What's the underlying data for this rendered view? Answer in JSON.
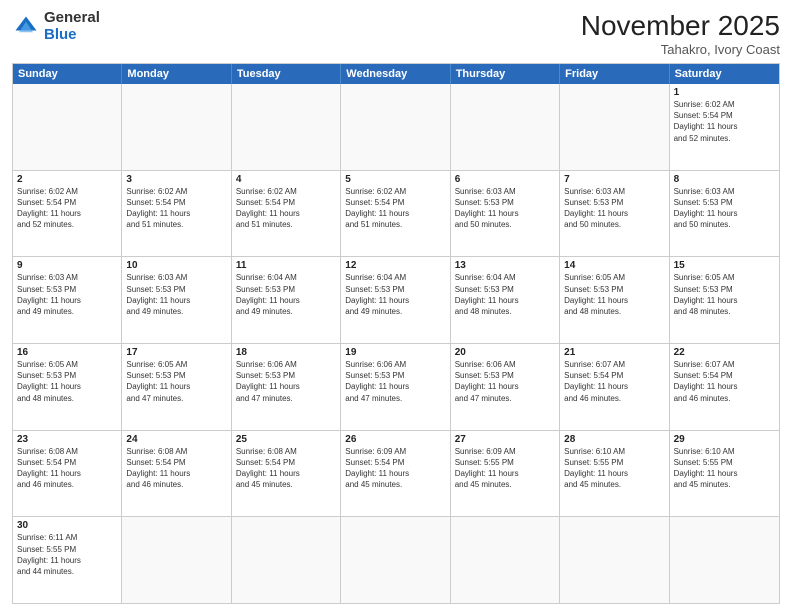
{
  "header": {
    "logo_general": "General",
    "logo_blue": "Blue",
    "month_title": "November 2025",
    "subtitle": "Tahakro, Ivory Coast"
  },
  "day_headers": [
    "Sunday",
    "Monday",
    "Tuesday",
    "Wednesday",
    "Thursday",
    "Friday",
    "Saturday"
  ],
  "weeks": [
    [
      {
        "num": "",
        "info": ""
      },
      {
        "num": "",
        "info": ""
      },
      {
        "num": "",
        "info": ""
      },
      {
        "num": "",
        "info": ""
      },
      {
        "num": "",
        "info": ""
      },
      {
        "num": "",
        "info": ""
      },
      {
        "num": "1",
        "info": "Sunrise: 6:02 AM\nSunset: 5:54 PM\nDaylight: 11 hours\nand 52 minutes."
      }
    ],
    [
      {
        "num": "2",
        "info": "Sunrise: 6:02 AM\nSunset: 5:54 PM\nDaylight: 11 hours\nand 52 minutes."
      },
      {
        "num": "3",
        "info": "Sunrise: 6:02 AM\nSunset: 5:54 PM\nDaylight: 11 hours\nand 51 minutes."
      },
      {
        "num": "4",
        "info": "Sunrise: 6:02 AM\nSunset: 5:54 PM\nDaylight: 11 hours\nand 51 minutes."
      },
      {
        "num": "5",
        "info": "Sunrise: 6:02 AM\nSunset: 5:54 PM\nDaylight: 11 hours\nand 51 minutes."
      },
      {
        "num": "6",
        "info": "Sunrise: 6:03 AM\nSunset: 5:53 PM\nDaylight: 11 hours\nand 50 minutes."
      },
      {
        "num": "7",
        "info": "Sunrise: 6:03 AM\nSunset: 5:53 PM\nDaylight: 11 hours\nand 50 minutes."
      },
      {
        "num": "8",
        "info": "Sunrise: 6:03 AM\nSunset: 5:53 PM\nDaylight: 11 hours\nand 50 minutes."
      }
    ],
    [
      {
        "num": "9",
        "info": "Sunrise: 6:03 AM\nSunset: 5:53 PM\nDaylight: 11 hours\nand 49 minutes."
      },
      {
        "num": "10",
        "info": "Sunrise: 6:03 AM\nSunset: 5:53 PM\nDaylight: 11 hours\nand 49 minutes."
      },
      {
        "num": "11",
        "info": "Sunrise: 6:04 AM\nSunset: 5:53 PM\nDaylight: 11 hours\nand 49 minutes."
      },
      {
        "num": "12",
        "info": "Sunrise: 6:04 AM\nSunset: 5:53 PM\nDaylight: 11 hours\nand 49 minutes."
      },
      {
        "num": "13",
        "info": "Sunrise: 6:04 AM\nSunset: 5:53 PM\nDaylight: 11 hours\nand 48 minutes."
      },
      {
        "num": "14",
        "info": "Sunrise: 6:05 AM\nSunset: 5:53 PM\nDaylight: 11 hours\nand 48 minutes."
      },
      {
        "num": "15",
        "info": "Sunrise: 6:05 AM\nSunset: 5:53 PM\nDaylight: 11 hours\nand 48 minutes."
      }
    ],
    [
      {
        "num": "16",
        "info": "Sunrise: 6:05 AM\nSunset: 5:53 PM\nDaylight: 11 hours\nand 48 minutes."
      },
      {
        "num": "17",
        "info": "Sunrise: 6:05 AM\nSunset: 5:53 PM\nDaylight: 11 hours\nand 47 minutes."
      },
      {
        "num": "18",
        "info": "Sunrise: 6:06 AM\nSunset: 5:53 PM\nDaylight: 11 hours\nand 47 minutes."
      },
      {
        "num": "19",
        "info": "Sunrise: 6:06 AM\nSunset: 5:53 PM\nDaylight: 11 hours\nand 47 minutes."
      },
      {
        "num": "20",
        "info": "Sunrise: 6:06 AM\nSunset: 5:53 PM\nDaylight: 11 hours\nand 47 minutes."
      },
      {
        "num": "21",
        "info": "Sunrise: 6:07 AM\nSunset: 5:54 PM\nDaylight: 11 hours\nand 46 minutes."
      },
      {
        "num": "22",
        "info": "Sunrise: 6:07 AM\nSunset: 5:54 PM\nDaylight: 11 hours\nand 46 minutes."
      }
    ],
    [
      {
        "num": "23",
        "info": "Sunrise: 6:08 AM\nSunset: 5:54 PM\nDaylight: 11 hours\nand 46 minutes."
      },
      {
        "num": "24",
        "info": "Sunrise: 6:08 AM\nSunset: 5:54 PM\nDaylight: 11 hours\nand 46 minutes."
      },
      {
        "num": "25",
        "info": "Sunrise: 6:08 AM\nSunset: 5:54 PM\nDaylight: 11 hours\nand 45 minutes."
      },
      {
        "num": "26",
        "info": "Sunrise: 6:09 AM\nSunset: 5:54 PM\nDaylight: 11 hours\nand 45 minutes."
      },
      {
        "num": "27",
        "info": "Sunrise: 6:09 AM\nSunset: 5:55 PM\nDaylight: 11 hours\nand 45 minutes."
      },
      {
        "num": "28",
        "info": "Sunrise: 6:10 AM\nSunset: 5:55 PM\nDaylight: 11 hours\nand 45 minutes."
      },
      {
        "num": "29",
        "info": "Sunrise: 6:10 AM\nSunset: 5:55 PM\nDaylight: 11 hours\nand 45 minutes."
      }
    ],
    [
      {
        "num": "30",
        "info": "Sunrise: 6:11 AM\nSunset: 5:55 PM\nDaylight: 11 hours\nand 44 minutes."
      },
      {
        "num": "",
        "info": ""
      },
      {
        "num": "",
        "info": ""
      },
      {
        "num": "",
        "info": ""
      },
      {
        "num": "",
        "info": ""
      },
      {
        "num": "",
        "info": ""
      },
      {
        "num": "",
        "info": ""
      }
    ]
  ]
}
